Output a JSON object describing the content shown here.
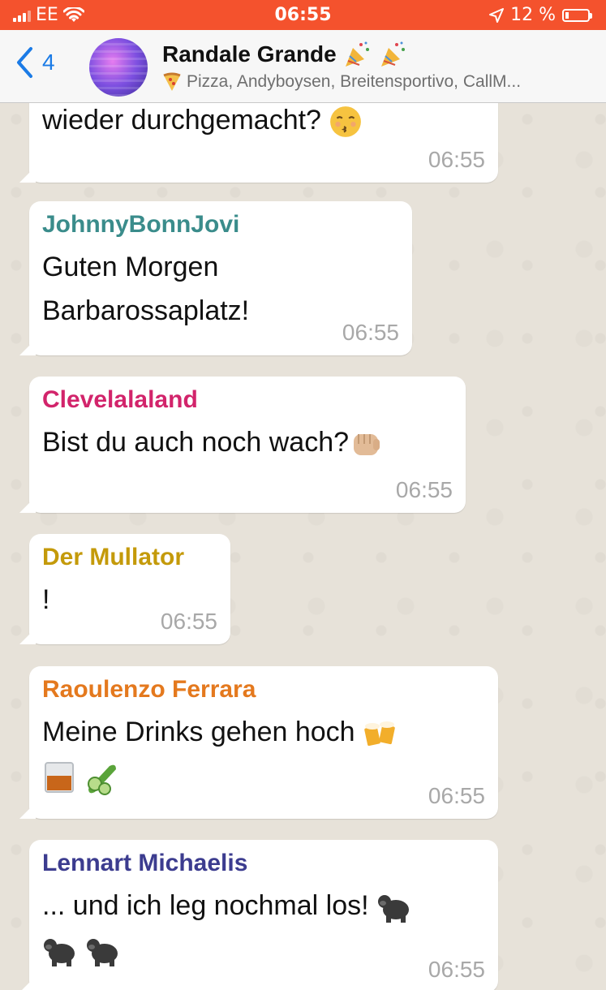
{
  "status_bar": {
    "carrier": "EE",
    "time": "06:55",
    "battery_percent": "12 %",
    "battery_level": 0.12
  },
  "header": {
    "back_count": "4",
    "title": "Randale Grande",
    "subtitle": "Pizza, Andyboysen, Breitensportivo, CallM..."
  },
  "messages": [
    {
      "sender": "",
      "text": "wieder durchgemacht?",
      "time": "06:55",
      "emoji": "kissing-face",
      "sender_color": ""
    },
    {
      "sender": "JohnnyBonnJovi",
      "text_line1": "Guten Morgen",
      "text_line2": "Barbarossaplatz!",
      "time": "06:55",
      "sender_color": "#3a8c8b"
    },
    {
      "sender": "Clevelalaland",
      "text": "Bist du auch noch wach?",
      "time": "06:55",
      "emoji": "fist-bump",
      "sender_color": "#d2246b"
    },
    {
      "sender": "Der Mullator",
      "text": "!",
      "time": "06:55",
      "sender_color": "#c49a0a"
    },
    {
      "sender": "Raoulenzo Ferrara",
      "text": "Meine Drinks gehen hoch",
      "time": "06:55",
      "emoji": "beer-mugs whisky-glass cucumber",
      "sender_color": "#e4791e"
    },
    {
      "sender": "Lennart Michaelis",
      "text": "... und ich leg nochmal los!",
      "time": "06:55",
      "emoji": "gorilla gorilla gorilla",
      "sender_color": "#3c3c8f"
    }
  ]
}
